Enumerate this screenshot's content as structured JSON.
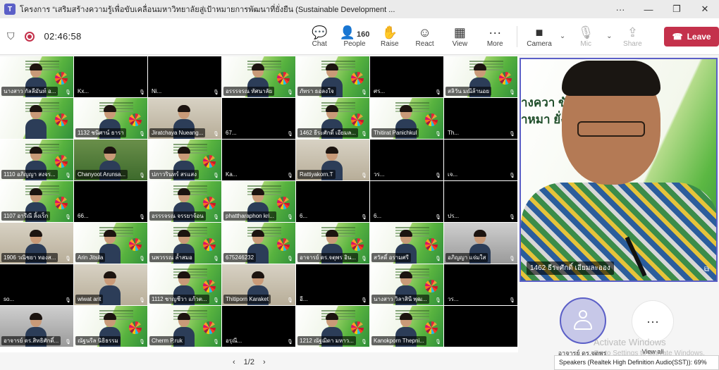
{
  "window": {
    "title": "โครงการ “เสริมสร้างความรู้เพื่อขับเคลื่อนมหาวิทยาลัยสู่เป้าหมายการพัฒนาที่ยั่งยืน (Sustainable Development ...",
    "app_icon": "T",
    "controls": [
      "···",
      "—",
      "❐",
      "✕"
    ]
  },
  "meeting": {
    "timer": "02:46:58",
    "people_count": "160",
    "buttons": {
      "chat": "Chat",
      "people": "People",
      "raise": "Raise",
      "react": "React",
      "view": "View",
      "more": "More",
      "camera": "Camera",
      "mic": "Mic",
      "share": "Share",
      "leave": "Leave"
    },
    "icons": {
      "chat": "💬",
      "people": "👤",
      "raise": "✋",
      "react": "☺",
      "view": "▦",
      "more": "···",
      "camera": "■",
      "mic": "🎙",
      "share": "⇪",
      "leave": "☎",
      "shield": "⛉",
      "chevron": "⌄"
    }
  },
  "participants": [
    {
      "name": "นางสาว กัลลีมันท์ อ...",
      "style": "slide"
    },
    {
      "name": "Kx...",
      "style": "black"
    },
    {
      "name": "Ni...",
      "style": "black"
    },
    {
      "name": "อรรรจรณ ทัศนาลัย",
      "style": "slide"
    },
    {
      "name": "ภัทรา ธอลงใจ",
      "style": "slide"
    },
    {
      "name": "ศร...",
      "style": "black"
    },
    {
      "name": "สลิวัน มณีล้านอย",
      "style": "slide"
    },
    {
      "name": "",
      "style": "slide"
    },
    {
      "name": "1132 ชนิศาน์ ธารา",
      "style": "slide"
    },
    {
      "name": "Jiratchaya Nueang...",
      "style": "room"
    },
    {
      "name": "67...",
      "style": "black"
    },
    {
      "name": "1462 ธีระศักดิ์ เอียมล...",
      "style": "slide"
    },
    {
      "name": "Thitirat Panichkul",
      "style": "slide"
    },
    {
      "name": "Th...",
      "style": "black"
    },
    {
      "name": "1110 อภิญญา สงจร...",
      "style": "slide"
    },
    {
      "name": "Chanyoot Arunsa...",
      "style": "garden"
    },
    {
      "name": "ปภาวรินทร์ สรแสง",
      "style": "slide"
    },
    {
      "name": "Ka...",
      "style": "black"
    },
    {
      "name": "Rattiyakorn.T",
      "style": "room"
    },
    {
      "name": "วร...",
      "style": "black"
    },
    {
      "name": "เจ...",
      "style": "black"
    },
    {
      "name": "1107 อารีณี ลิ้งเร็ก",
      "style": "slide"
    },
    {
      "name": "66...",
      "style": "black"
    },
    {
      "name": "อรรรจรณ จรรยาจ้อน",
      "style": "slide"
    },
    {
      "name": "phattharaphon kri...",
      "style": "slide"
    },
    {
      "name": "6...",
      "style": "black"
    },
    {
      "name": "6...",
      "style": "black"
    },
    {
      "name": "ปร...",
      "style": "black"
    },
    {
      "name": "1906 วณิชยา ทองส...",
      "style": "room"
    },
    {
      "name": "Arin Jitsila",
      "style": "slide"
    },
    {
      "name": "นพวรรณ ล้ำสมอ",
      "style": "slide"
    },
    {
      "name": "675246232",
      "style": "slide"
    },
    {
      "name": "อาจารย์ ดร.จตุพร อิน...",
      "style": "slide"
    },
    {
      "name": "สวัสดิ์ อรามศรี",
      "style": "slide"
    },
    {
      "name": "อภิญญา แจ่มใส",
      "style": "gray"
    },
    {
      "name": "so...",
      "style": "black"
    },
    {
      "name": "wiwat arit",
      "style": "room"
    },
    {
      "name": "1112 ชาญชีวา แก้วต...",
      "style": "slide"
    },
    {
      "name": "Thitiporn Karaket",
      "style": "room"
    },
    {
      "name": "อี...",
      "style": "black"
    },
    {
      "name": "นางสาว วิลาสินี พุฒ...",
      "style": "slide"
    },
    {
      "name": "วร...",
      "style": "black"
    },
    {
      "name": "อาจารย์ ดร.สิทธิศักดิ์...",
      "style": "gray"
    },
    {
      "name": "ณัฐนรีล นิธิธรรม",
      "style": "slide"
    },
    {
      "name": "Cherm P.ruk",
      "style": "slide"
    },
    {
      "name": "อรุณี...",
      "style": "black"
    },
    {
      "name": "1212 ณัฐฌิดา มหาว...",
      "style": "slide"
    },
    {
      "name": "Kanokporn Thepni...",
      "style": "slide"
    },
    {
      "name": "",
      "style": "black"
    }
  ],
  "spotlight": {
    "name": "1462 ธีระศักดิ์ เอียมละออง",
    "slide_line1": "างควา        ขับเคลื่อน",
    "slide_line2": "าหมา          ยั่งยืน"
  },
  "sidebar": {
    "avatar_label": "อาจารย์ ดร.จตุพร",
    "view_all_label": "View all",
    "view_all_icon": "···"
  },
  "watermark": {
    "line1": "Activate Windows",
    "line2": "Go to Settings to activate Windows."
  },
  "pager": {
    "prev": "‹",
    "label": "1/2",
    "next": "›"
  },
  "status": {
    "speakers": "Speakers (Realtek High Definition Audio(SST)): 69%"
  }
}
